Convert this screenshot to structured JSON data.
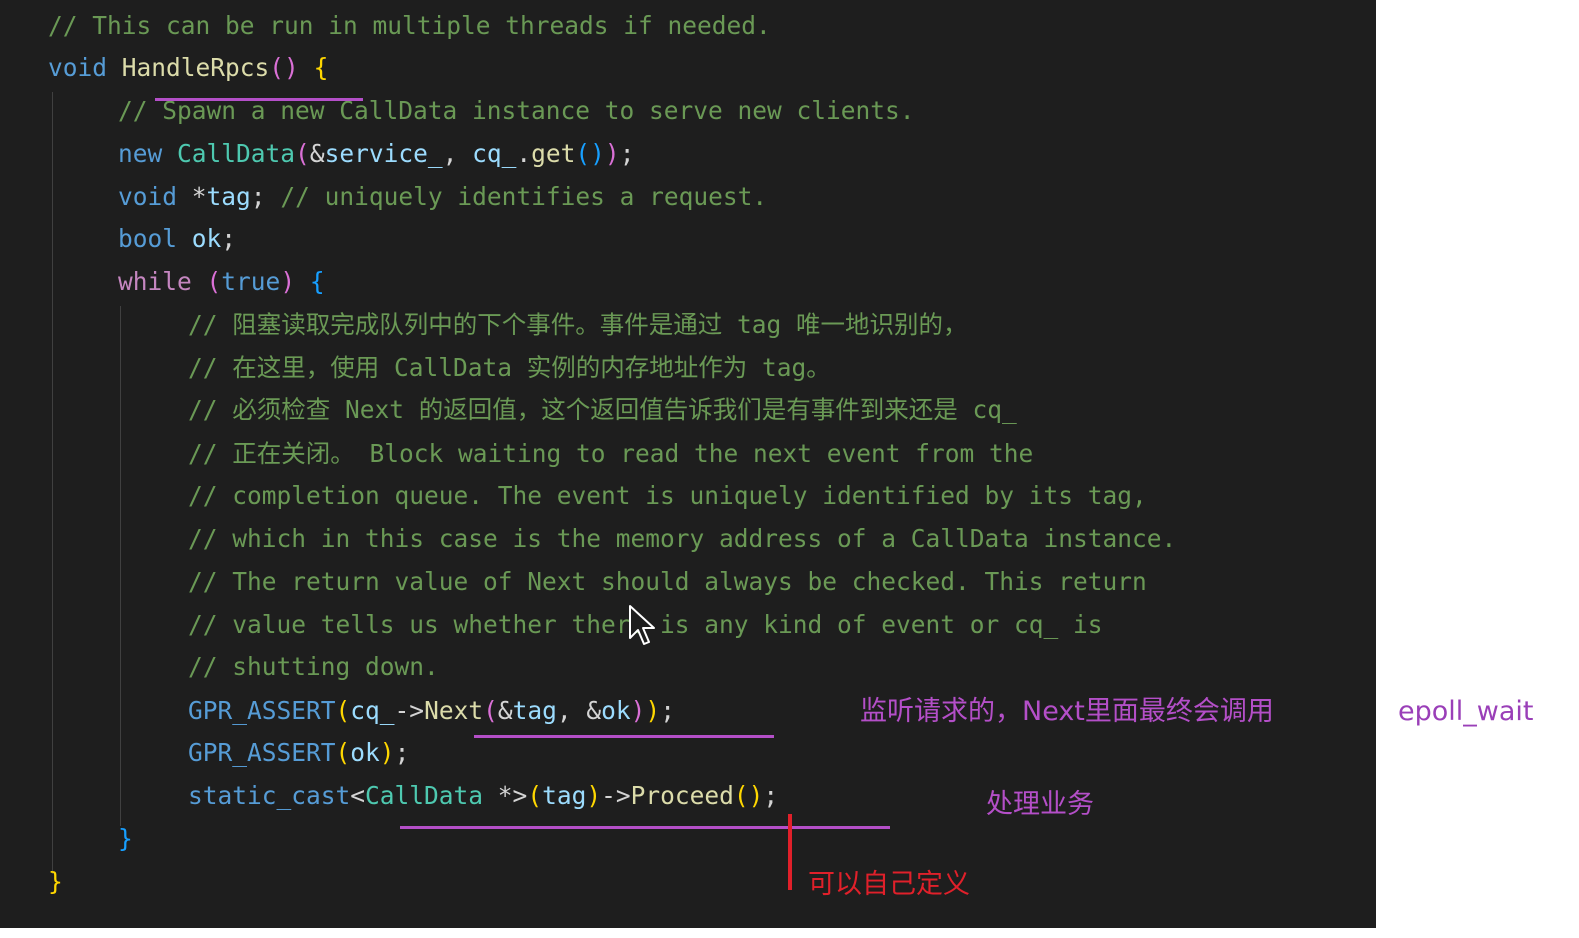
{
  "code_lines": [
    "// This can be run in multiple threads if needed.",
    "void HandleRpcs() {",
    "// Spawn a new CallData instance to serve new clients.",
    "new CallData(&service_, cq_.get());",
    "void *tag; // uniquely identifies a request.",
    "bool ok;",
    "while (true) {",
    "// 阻塞读取完成队列中的下个事件。事件是通过 tag 唯一地识别的，",
    "// 在这里，使用 CallData 实例的内存地址作为 tag。",
    "// 必须检查 Next 的返回值，这个返回值告诉我们是有事件到来还是 cq_",
    "// 正在关闭。 Block waiting to read the next event from the",
    "// completion queue. The event is uniquely identified by its tag,",
    "// which in this case is the memory address of a CallData instance.",
    "// The return value of Next should always be checked. This return",
    "// value tells us whether there is any kind of event or cq_ is",
    "// shutting down.",
    "GPR_ASSERT(cq_->Next(&tag, &ok));",
    "GPR_ASSERT(ok);",
    "static_cast<CallData *>(tag)->Proceed();",
    "}",
    "}"
  ],
  "annotations": {
    "next_note": "监听请求的，Next里面最终会调用",
    "epoll_note": "epoll_wait",
    "proceed_note": "处理业务",
    "custom_note": "可以自己定义"
  },
  "colors": {
    "editor_background": "#1e1e1e",
    "keyword": "#569cd6",
    "control_keyword": "#c586c0",
    "function": "#dcdcaa",
    "type": "#4ec9b0",
    "variable": "#9cdcfe",
    "comment": "#6a9955",
    "annotation_purple": "#b44fc8",
    "annotation_red": "#e0202a"
  },
  "icons": {
    "mouse_cursor": "arrow-cursor-icon"
  }
}
